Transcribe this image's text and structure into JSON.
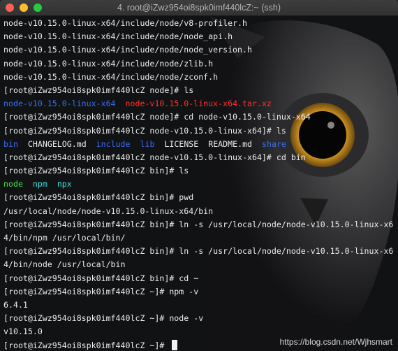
{
  "window": {
    "title": "4. root@iZwz954oi8spk0imf440lcZ:~ (ssh)"
  },
  "terminal": {
    "lines": [
      [
        {
          "t": "node-v10.15.0-linux-x64/include/node/v8-profiler.h"
        }
      ],
      [
        {
          "t": "node-v10.15.0-linux-x64/include/node/node_api.h"
        }
      ],
      [
        {
          "t": "node-v10.15.0-linux-x64/include/node/node_version.h"
        }
      ],
      [
        {
          "t": "node-v10.15.0-linux-x64/include/node/zlib.h"
        }
      ],
      [
        {
          "t": "node-v10.15.0-linux-x64/include/node/zconf.h"
        }
      ],
      [
        {
          "t": "[root@iZwz954oi8spk0imf440lcZ node]# ls"
        }
      ],
      [
        {
          "t": "node-v10.15.0-linux-x64",
          "c": "blue"
        },
        {
          "t": "  "
        },
        {
          "t": "node-v10.15.0-linux-x64.tar.xz",
          "c": "red"
        }
      ],
      [
        {
          "t": "[root@iZwz954oi8spk0imf440lcZ node]# cd node-v10.15.0-linux-x64"
        }
      ],
      [
        {
          "t": "[root@iZwz954oi8spk0imf440lcZ node-v10.15.0-linux-x64]# ls"
        }
      ],
      [
        {
          "t": "bin",
          "c": "blue"
        },
        {
          "t": "  CHANGELOG.md  "
        },
        {
          "t": "include",
          "c": "blue"
        },
        {
          "t": "  "
        },
        {
          "t": "lib",
          "c": "blue"
        },
        {
          "t": "  LICENSE  README.md  "
        },
        {
          "t": "share",
          "c": "blue"
        }
      ],
      [
        {
          "t": "[root@iZwz954oi8spk0imf440lcZ node-v10.15.0-linux-x64]# cd bin"
        }
      ],
      [
        {
          "t": "[root@iZwz954oi8spk0imf440lcZ bin]# ls"
        }
      ],
      [
        {
          "t": "node",
          "c": "green"
        },
        {
          "t": "  "
        },
        {
          "t": "npm",
          "c": "cyan"
        },
        {
          "t": "  "
        },
        {
          "t": "npx",
          "c": "cyan"
        }
      ],
      [
        {
          "t": "[root@iZwz954oi8spk0imf440lcZ bin]# pwd"
        }
      ],
      [
        {
          "t": "/usr/local/node/node-v10.15.0-linux-x64/bin"
        }
      ],
      [
        {
          "t": "[root@iZwz954oi8spk0imf440lcZ bin]# ln -s /usr/local/node/node-v10.15.0-linux-x6"
        }
      ],
      [
        {
          "t": "4/bin/npm /usr/local/bin/"
        }
      ],
      [
        {
          "t": "[root@iZwz954oi8spk0imf440lcZ bin]# ln -s /usr/local/node/node-v10.15.0-linux-x6"
        }
      ],
      [
        {
          "t": "4/bin/node /usr/local/bin"
        }
      ],
      [
        {
          "t": "[root@iZwz954oi8spk0imf440lcZ bin]# cd ~"
        }
      ],
      [
        {
          "t": "[root@iZwz954oi8spk0imf440lcZ ~]# npm -v"
        }
      ],
      [
        {
          "t": "6.4.1"
        }
      ],
      [
        {
          "t": "[root@iZwz954oi8spk0imf440lcZ ~]# node -v"
        }
      ],
      [
        {
          "t": "v10.15.0"
        }
      ],
      [
        {
          "t": "[root@iZwz954oi8spk0imf440lcZ ~]# "
        }
      ]
    ]
  },
  "watermark": "https://blog.csdn.net/Wjhsmart",
  "colors": {
    "titlebar": "#3a3a3a",
    "background": "#111214",
    "text": "#ececec",
    "dir_blue": "#3b6df0",
    "archive_red": "#ff3030",
    "exec_green": "#4ade4a",
    "link_cyan": "#38e0e0"
  }
}
